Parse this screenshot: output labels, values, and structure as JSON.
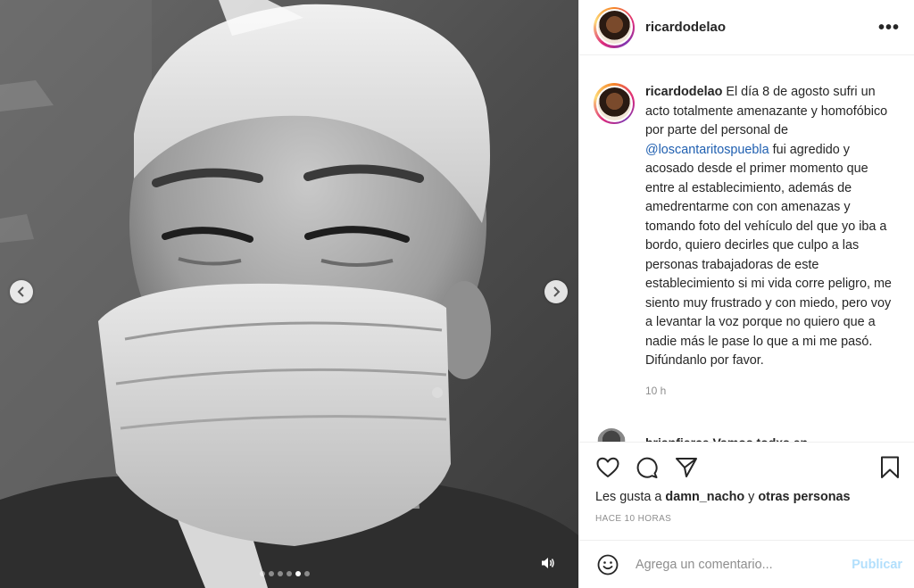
{
  "post": {
    "username": "ricardodelao",
    "more_label": "•••",
    "caption_text": " El día 8 de agosto sufri un acto totalmente amenazante y homofóbico por parte del personal de ",
    "mention": "@loscantaritospuebla",
    "caption_rest": " fui agredido y acosado desde el primer momento que entre al establecimiento, además de amedrentarme con con amenazas y tomando foto del vehículo del que yo iba a bordo, quiero decirles que culpo a las personas trabajadoras de este establecimiento si mi vida corre peligro, me siento muy frustrado y con miedo, pero voy a levantar la voz porque no quiero que a nadie más le pase lo que a mi me pasó. Difúndanlo por favor.",
    "caption_time": "10 h",
    "peek_comment": "brianfierce Vamos todxs en"
  },
  "likes": {
    "prefix": "Les gusta a ",
    "user": "damn_nacho",
    "middle": " y ",
    "others": "otras personas"
  },
  "time_ago": "HACE 10 HORAS",
  "comment_box": {
    "placeholder": "Agrega un comentario...",
    "publish_label": "Publicar"
  },
  "carousel": {
    "total_slides": 6,
    "active_index": 4
  },
  "colors": {
    "mention": "#1f5fb0",
    "publish": "#b2dffc",
    "muted": "#8e8e8e"
  }
}
